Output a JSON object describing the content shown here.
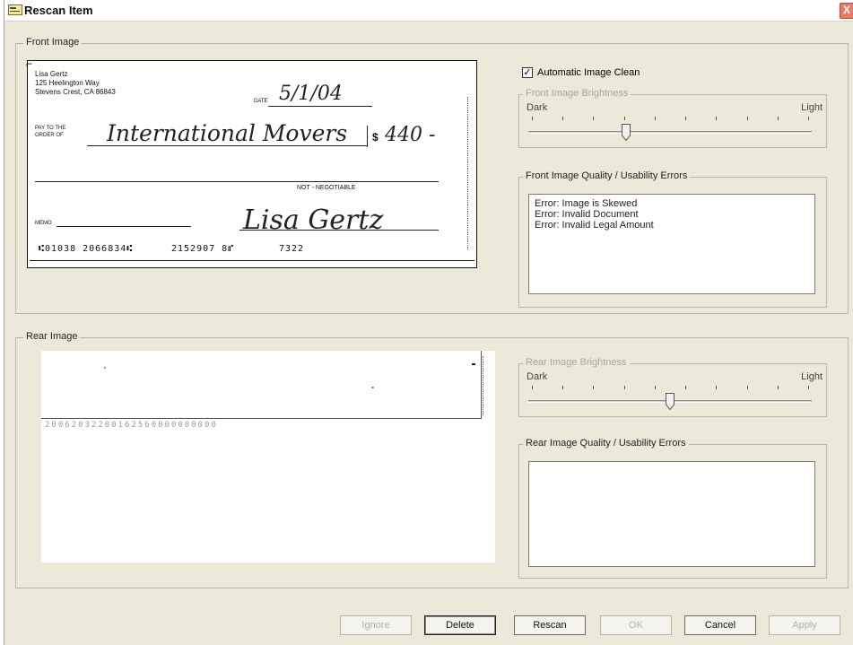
{
  "window": {
    "title": "Rescan Item",
    "close_glyph": "X"
  },
  "front": {
    "group_label": "Front Image",
    "auto_clean": {
      "label": "Automatic Image Clean",
      "checked": true,
      "check_glyph": "✓"
    },
    "brightness": {
      "group_label": "Front Image Brightness",
      "dark_label": "Dark",
      "light_label": "Light",
      "value": 0.34
    },
    "errors": {
      "group_label": "Front Image Quality / Usability Errors",
      "items": [
        "Error: Image is Skewed",
        "Error: Invalid Document",
        "Error: Invalid Legal Amount"
      ]
    },
    "check": {
      "payer_name": "Lisa Gertz",
      "payer_addr1": "125 Heelington Way",
      "payer_addr2": "Stevens Crest, CA 86843",
      "date_label": "DATE",
      "date_value": "5/1/04",
      "pay_to_label1": "PAY TO THE",
      "pay_to_label2": "ORDER OF",
      "payee": "International Movers",
      "dollar_sign": "$",
      "amount": "440 -",
      "not_negotiable": "NOT - NEGOTIABLE",
      "memo_label": "MEMO",
      "signature": "Lisa Gertz",
      "micr_routing": "⑆01038 2066834⑆",
      "micr_account": "2152907 8⑈",
      "micr_check": "7322"
    }
  },
  "rear": {
    "group_label": "Rear Image",
    "brightness": {
      "group_label": "Rear Image Brightness",
      "dark_label": "Dark",
      "light_label": "Light",
      "value": 0.5
    },
    "errors": {
      "group_label": "Rear Image Quality / Usability Errors",
      "items": []
    },
    "endorsement_text": "20062032200162560000000000"
  },
  "buttons": {
    "ignore": "Ignore",
    "delete": "Delete",
    "rescan": "Rescan",
    "ok": "OK",
    "cancel": "Cancel",
    "apply": "Apply"
  }
}
